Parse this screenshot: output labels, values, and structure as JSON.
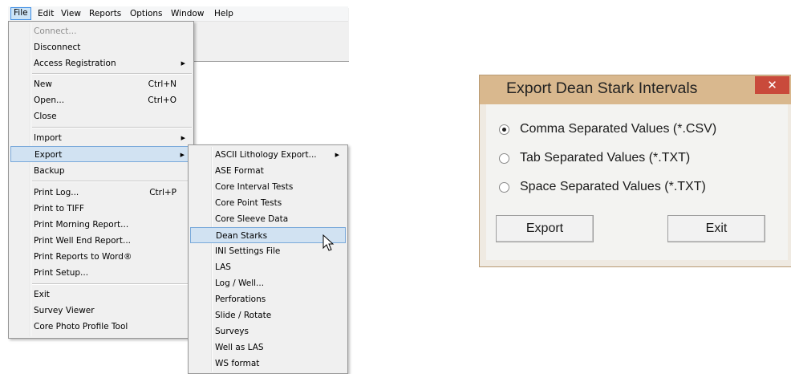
{
  "menubar": {
    "items": [
      "File",
      "Edit",
      "View",
      "Reports",
      "Options",
      "Window",
      "Help"
    ]
  },
  "file_menu": {
    "items": [
      {
        "label": "Connect...",
        "disabled": true
      },
      {
        "label": "Disconnect"
      },
      {
        "label": "Access Registration",
        "submenu": true
      },
      {
        "label": "New",
        "shortcut": "Ctrl+N"
      },
      {
        "label": "Open...",
        "shortcut": "Ctrl+O"
      },
      {
        "label": "Close"
      },
      {
        "label": "Import",
        "submenu": true
      },
      {
        "label": "Export",
        "submenu": true,
        "highlighted": true
      },
      {
        "label": "Backup"
      },
      {
        "label": "Print Log...",
        "shortcut": "Ctrl+P"
      },
      {
        "label": "Print to TIFF"
      },
      {
        "label": "Print Morning Report..."
      },
      {
        "label": "Print Well End Report..."
      },
      {
        "label": "Print Reports to Word®"
      },
      {
        "label": "Print Setup..."
      },
      {
        "label": "Exit"
      },
      {
        "label": "Survey Viewer"
      },
      {
        "label": "Core Photo Profile Tool"
      }
    ]
  },
  "export_menu": {
    "items": [
      {
        "label": "ASCII Lithology Export...",
        "submenu": true
      },
      {
        "label": "ASE Format"
      },
      {
        "label": "Core Interval Tests"
      },
      {
        "label": "Core Point Tests"
      },
      {
        "label": "Core Sleeve Data"
      },
      {
        "label": "Dean Starks",
        "highlighted": true
      },
      {
        "label": "INI Settings File"
      },
      {
        "label": "LAS"
      },
      {
        "label": "Log / Well..."
      },
      {
        "label": "Perforations"
      },
      {
        "label": "Slide / Rotate"
      },
      {
        "label": "Surveys"
      },
      {
        "label": "Well as LAS"
      },
      {
        "label": "WS format"
      }
    ]
  },
  "dialog": {
    "title": "Export Dean Stark Intervals",
    "close_glyph": "✕",
    "options": [
      {
        "label": "Comma Separated Values (*.CSV)",
        "selected": true
      },
      {
        "label": "Tab Separated Values (*.TXT)",
        "selected": false
      },
      {
        "label": "Space Separated Values (*.TXT)",
        "selected": false
      }
    ],
    "export_label": "Export",
    "exit_label": "Exit"
  },
  "colors": {
    "titlebar": "#d9b88e",
    "close": "#c94a3b",
    "menu_highlight": "#d1e2f2"
  },
  "icons": {
    "submenu_arrow": "▶",
    "cursor": "arrow-cursor-icon"
  }
}
